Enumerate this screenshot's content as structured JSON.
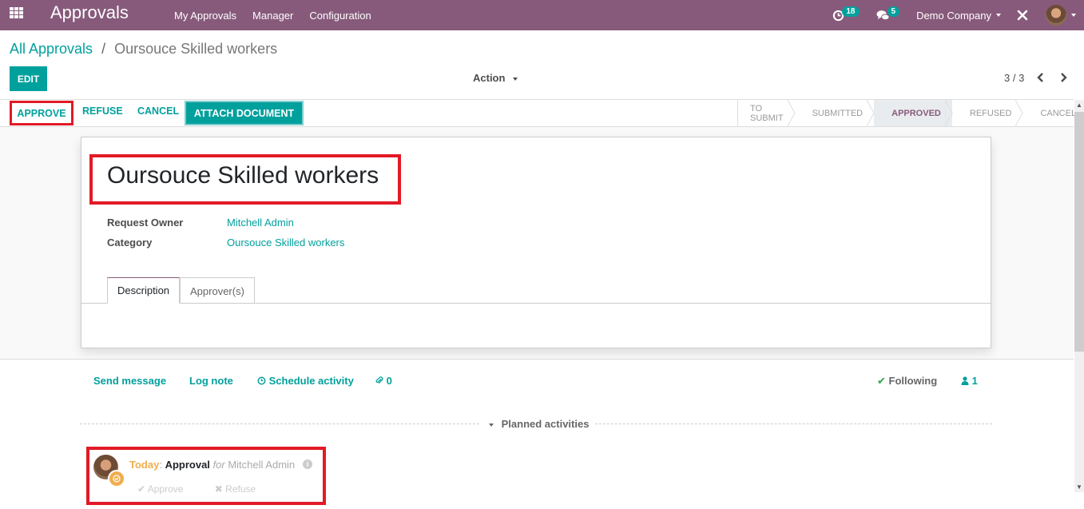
{
  "navbar": {
    "app_title": "Approvals",
    "menu": [
      "My Approvals",
      "Manager",
      "Configuration"
    ],
    "activity_count": "18",
    "message_count": "5",
    "company": "Demo Company"
  },
  "breadcrumb": {
    "parent": "All Approvals",
    "separator": "/",
    "current": "Oursouce Skilled workers"
  },
  "control": {
    "edit_label": "EDIT",
    "action_label": "Action",
    "pager": "3 / 3"
  },
  "statusbar": {
    "buttons": [
      "APPROVE",
      "REFUSE",
      "CANCEL",
      "ATTACH DOCUMENT"
    ],
    "stages": [
      "TO SUBMIT",
      "SUBMITTED",
      "APPROVED",
      "REFUSED",
      "CANCEL"
    ],
    "active_stage": "APPROVED"
  },
  "record": {
    "title": "Oursouce Skilled workers",
    "fields": [
      {
        "label": "Request Owner",
        "value": "Mitchell Admin"
      },
      {
        "label": "Category",
        "value": "Oursouce Skilled workers"
      }
    ],
    "tabs": [
      "Description",
      "Approver(s)"
    ]
  },
  "chatter": {
    "send_message": "Send message",
    "log_note": "Log note",
    "schedule_activity": "Schedule activity",
    "attachments": "0",
    "following": "Following",
    "followers": "1",
    "planned_activities": "Planned activities",
    "activity": {
      "when": "Today",
      "colon": ":",
      "type": "Approval",
      "for": "for",
      "user": "Mitchell Admin",
      "approve": "Approve",
      "refuse": "Refuse"
    }
  },
  "colors": {
    "brand": "#875a7b",
    "accent": "#00a09d",
    "highlight": "#e21a26",
    "today": "#f0ad4e"
  }
}
